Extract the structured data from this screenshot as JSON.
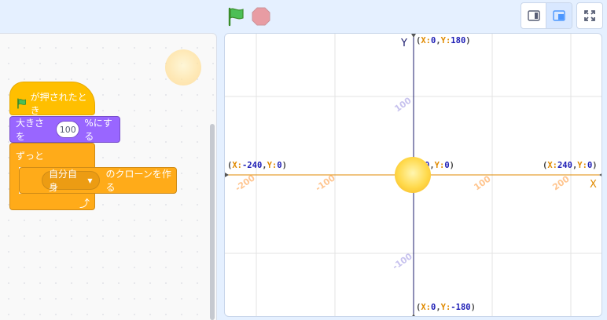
{
  "topbar": {
    "green_flag_icon": "green-flag",
    "stop_icon": "stop-sign",
    "small_stage_icon": "small-stage",
    "normal_stage_icon": "normal-stage",
    "fullscreen_icon": "fullscreen"
  },
  "code": {
    "hat_label": "が押されたとき",
    "size_prefix": "大きさを",
    "size_value": "100",
    "size_suffix": "%にする",
    "forever_label": "ずっと",
    "clone_target": "自分自身",
    "clone_suffix": "のクローンを作る"
  },
  "stage": {
    "y_axis_letter": "Y",
    "x_axis_letter": "X",
    "top": {
      "k1": "X:",
      "v1": "0",
      "sep": ",",
      "k2": "Y:",
      "v2": "180"
    },
    "bottom": {
      "k1": "X:",
      "v1": "0",
      "sep": ",",
      "k2": "Y:",
      "v2": "-180"
    },
    "left": {
      "k1": "X:",
      "v1": "-240",
      "sep": ",",
      "k2": "Y:",
      "v2": "0"
    },
    "right": {
      "k1": "X:",
      "v1": "240",
      "sep": ",",
      "k2": "Y:",
      "v2": "0"
    },
    "center": {
      "v1": "0",
      "sep": ",",
      "k2": "Y:",
      "v2": "0"
    },
    "x_ticks": [
      "-200",
      "-100",
      "100",
      "200"
    ],
    "y_ticks": [
      "100",
      "-100"
    ]
  },
  "colors": {
    "events": "#ffbf00",
    "looks": "#9966ff",
    "control": "#ffab19",
    "x_axis": "#e08a00",
    "y_axis": "#1c1c6e"
  }
}
